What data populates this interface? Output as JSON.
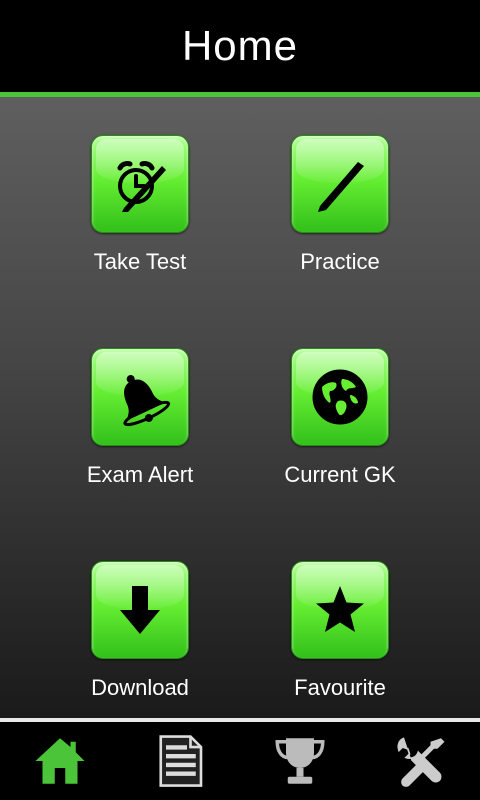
{
  "header": {
    "title": "Home"
  },
  "tiles": [
    {
      "label": "Take Test",
      "icon": "alarm-clock-pencil-icon"
    },
    {
      "label": "Practice",
      "icon": "pencil-icon"
    },
    {
      "label": "Exam Alert",
      "icon": "bell-icon"
    },
    {
      "label": "Current GK",
      "icon": "globe-icon"
    },
    {
      "label": "Download",
      "icon": "download-arrow-icon"
    },
    {
      "label": "Favourite",
      "icon": "star-icon"
    }
  ],
  "bottom_nav": [
    {
      "icon": "home-icon",
      "active": true
    },
    {
      "icon": "document-icon",
      "active": false
    },
    {
      "icon": "trophy-icon",
      "active": false
    },
    {
      "icon": "tools-icon",
      "active": false
    }
  ],
  "colors": {
    "accent": "#4cc43a",
    "tile_green": "#66ee33",
    "header_bg": "#000000",
    "active_nav": "#4cc43a",
    "inactive_nav": "#dddddd"
  }
}
